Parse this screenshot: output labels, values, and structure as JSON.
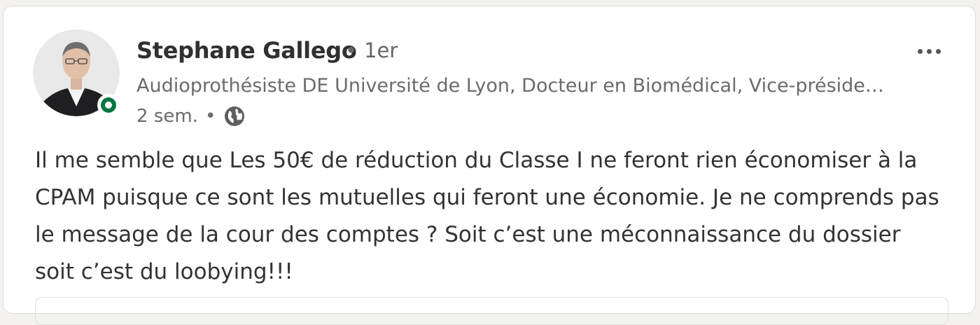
{
  "post": {
    "author": {
      "name": "Stephane Gallego",
      "separator": "•",
      "connection_degree": "1er",
      "headline": "Audioprothésiste DE Université de Lyon, Docteur en Biomédical, Vice-préside…",
      "avatar_icon": "profile-photo",
      "presence_status": "online",
      "presence_color": "#057642"
    },
    "meta": {
      "time_ago": "2 sem.",
      "separator": "•",
      "visibility_icon": "globe-icon"
    },
    "more_icon": "ellipsis-icon",
    "text": "Il me semble que Les 50€ de réduction du Classe I ne feront rien économiser à la CPAM puisque ce sont les mutuelles qui feront une économie. Je ne comprends pas le message de la cour des comptes ? Soit c’est une méconnaissance du dossier soit c’est du loobying!!!"
  }
}
